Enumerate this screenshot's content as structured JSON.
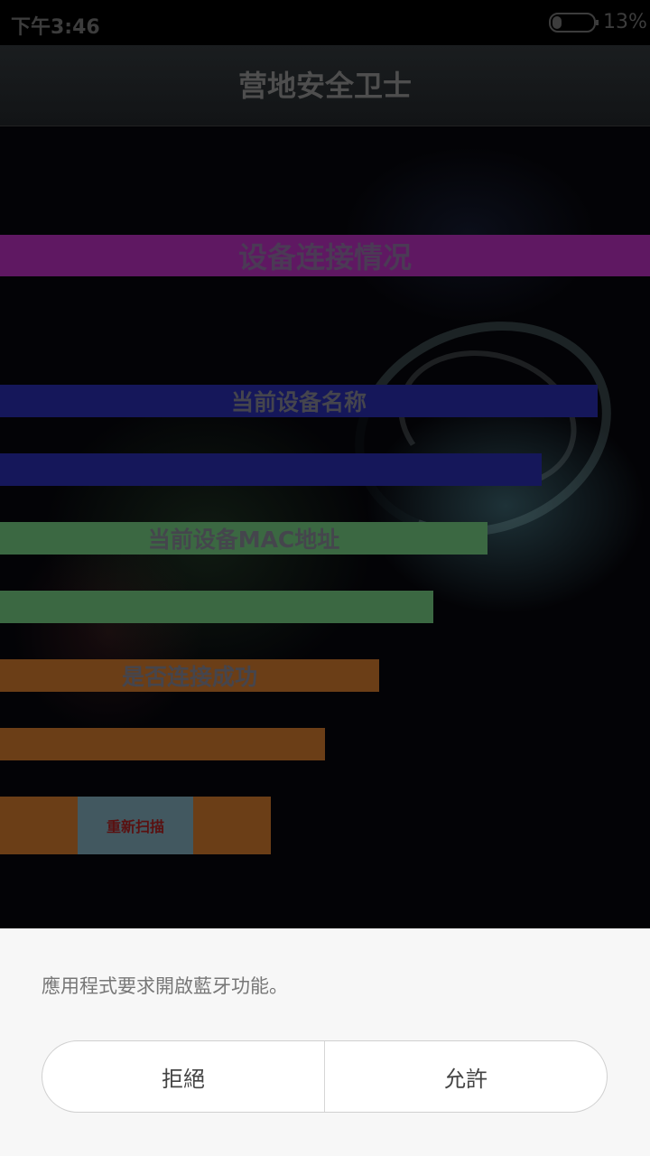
{
  "status_bar": {
    "time": "下午3:46",
    "battery_percent": "13%",
    "battery_level": 0.13
  },
  "app": {
    "title": "营地安全卫士"
  },
  "main": {
    "section_title": "设备连接情况",
    "device_name_label": "当前设备名称",
    "device_name_value": "",
    "mac_label": "当前设备MAC地址",
    "mac_value": "",
    "connection_label": "是否连接成功",
    "connection_value": "",
    "rescan_label": "重新扫描"
  },
  "dialog": {
    "message": "應用程式要求開啟藍牙功能。",
    "deny_label": "拒絕",
    "allow_label": "允許"
  },
  "colors": {
    "section_bar": "#5f1862",
    "name_bar": "#15175a",
    "mac_bar": "#3b6842",
    "connection_bar": "#6b3e17",
    "rescan_button": "#425860"
  }
}
